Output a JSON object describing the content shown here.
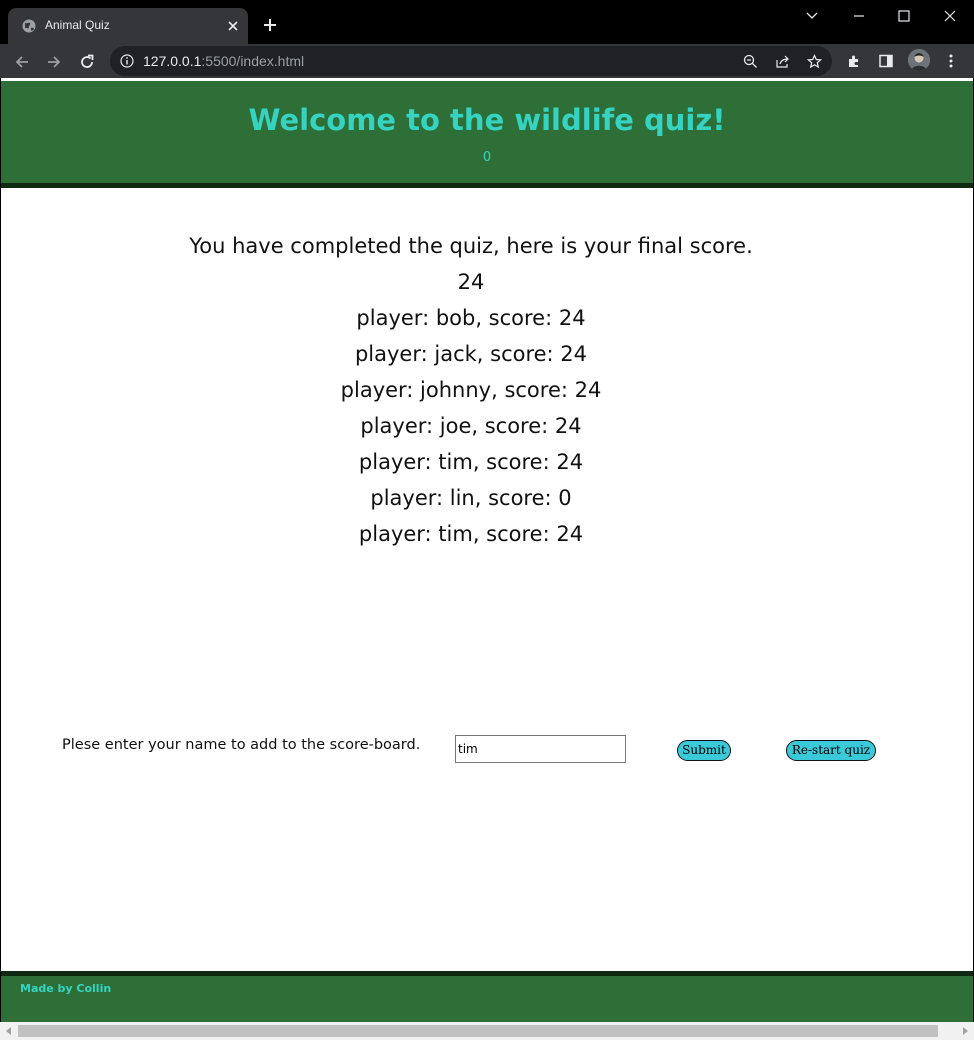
{
  "browser": {
    "tab_title": "Animal Quiz",
    "url_host": "127.0.0.1",
    "url_rest": ":5500/index.html"
  },
  "header": {
    "title": "Welcome to the wildlife quiz!",
    "score_counter": "0"
  },
  "results": {
    "message": "You have completed the quiz, here is your final score.",
    "final_score": "24",
    "scoreboard": [
      "player: bob, score: 24",
      "player: jack, score: 24",
      "player: johnny, score: 24",
      "player: joe, score: 24",
      "player: tim, score: 24",
      "player: lin, score: 0",
      "player: tim, score: 24"
    ]
  },
  "form": {
    "label": "Plese enter your name to add to the score-board.",
    "name_value": "tim",
    "submit_label": "Submit",
    "restart_label": "Re-start quiz"
  },
  "footer": {
    "credit": "Made by Collin"
  },
  "colors": {
    "header_bg": "#2e6e37",
    "accent_text": "#35d4c2",
    "button_bg": "#39c9d9"
  },
  "icons": [
    "globe-icon",
    "close-icon",
    "plus-icon",
    "chevron-down-icon",
    "minimize-icon",
    "maximize-icon",
    "back-icon",
    "forward-icon",
    "reload-icon",
    "info-icon",
    "zoom-icon",
    "share-icon",
    "star-icon",
    "extensions-icon",
    "side-panel-icon",
    "profile-avatar",
    "menu-icon"
  ]
}
